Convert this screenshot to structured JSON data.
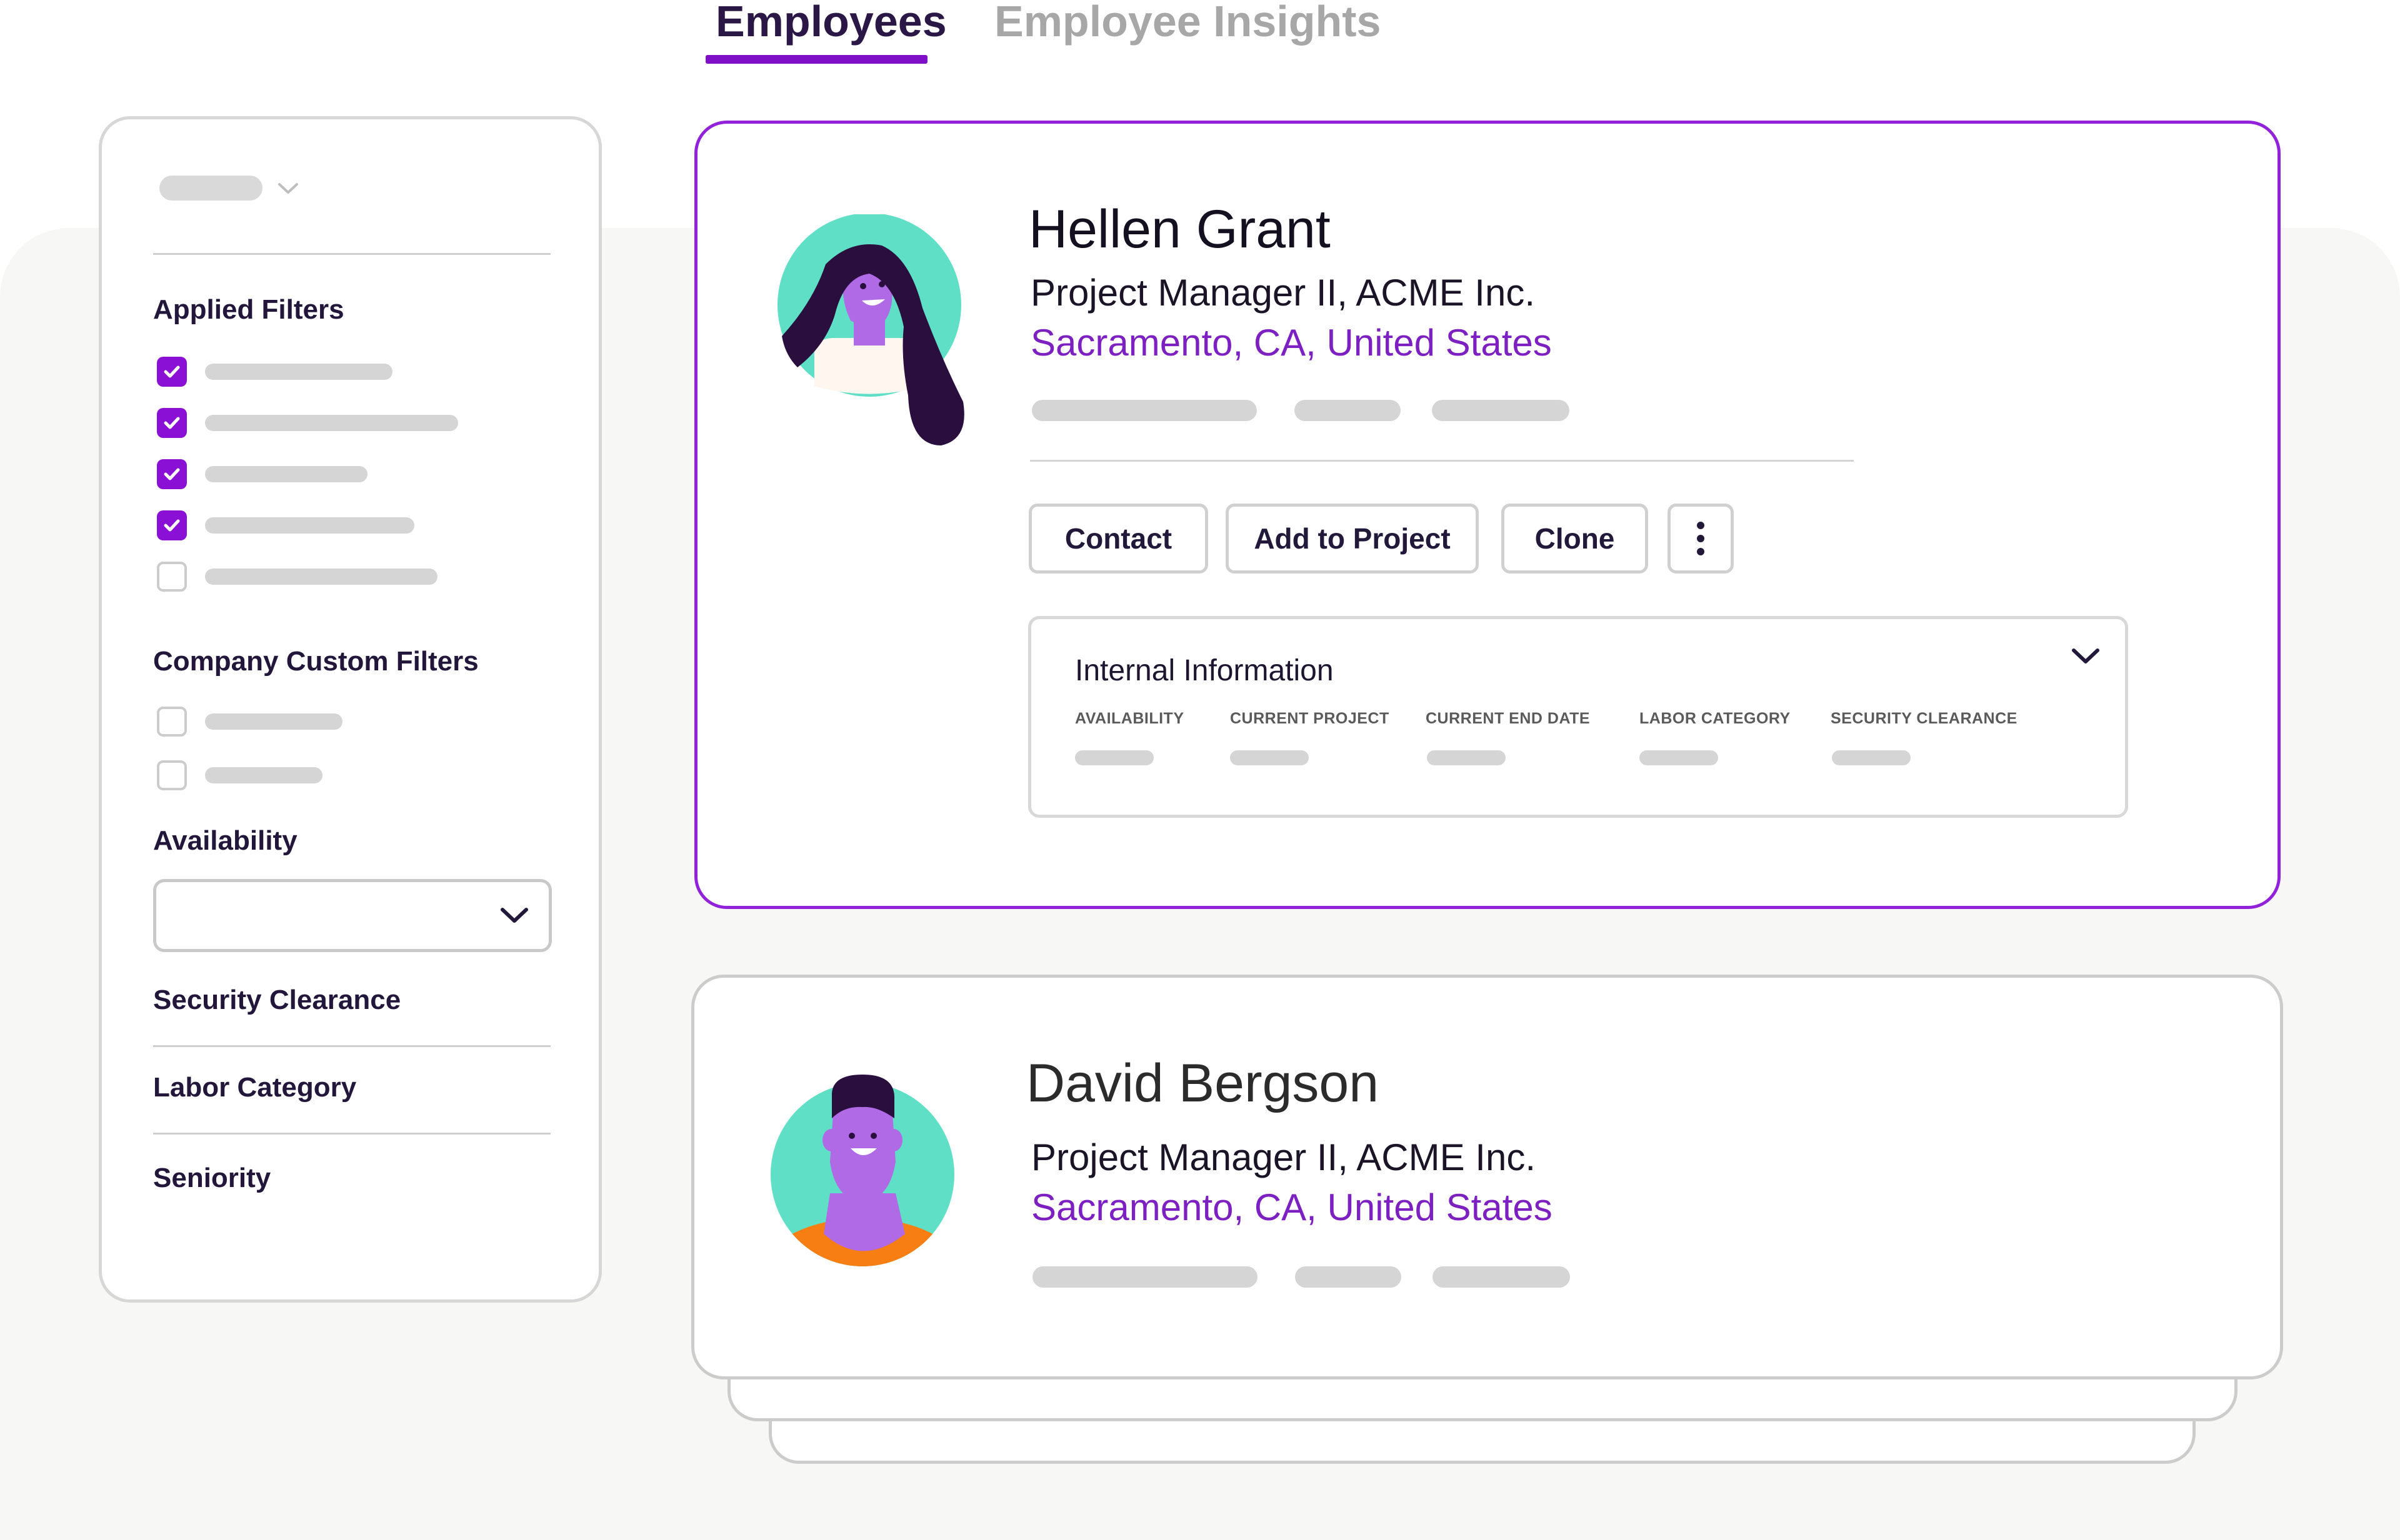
{
  "tabs": [
    {
      "label": "Employees",
      "active": true
    },
    {
      "label": "Employee Insights",
      "active": false
    }
  ],
  "colors": {
    "accent": "#8a10d6",
    "location": "#7d20c2",
    "avatar_bg": "#5fe0c6",
    "avatar_skin": "#b06ae6",
    "hair": "#2a0f3e",
    "shirt_orange": "#f77e12"
  },
  "sidebar": {
    "applied_filters_label": "Applied Filters",
    "applied_filters_checked": [
      true,
      true,
      true,
      true,
      false
    ],
    "company_custom_filters_label": "Company Custom Filters",
    "company_custom_filters_checked": [
      false,
      false
    ],
    "availability_label": "Availability",
    "availability_value": "",
    "sections": [
      "Security Clearance",
      "Labor Category",
      "Seniority"
    ]
  },
  "employees": [
    {
      "name": "Hellen Grant",
      "role": "Project Manager II, ACME Inc.",
      "location": "Sacramento, CA, United States",
      "avatar": "woman-avatar-icon"
    },
    {
      "name": "David Bergson",
      "role": "Project Manager II, ACME Inc.",
      "location": "Sacramento, CA, United States",
      "avatar": "man-avatar-icon"
    }
  ],
  "actions": {
    "contact": "Contact",
    "add_to_project": "Add to Project",
    "clone": "Clone",
    "more_icon": "more-vertical-icon"
  },
  "internal_info": {
    "title": "Internal Information",
    "columns": [
      "AVAILABILITY",
      "CURRENT PROJECT",
      "CURRENT END DATE",
      "LABOR CATEGORY",
      "SECURITY CLEARANCE"
    ]
  }
}
